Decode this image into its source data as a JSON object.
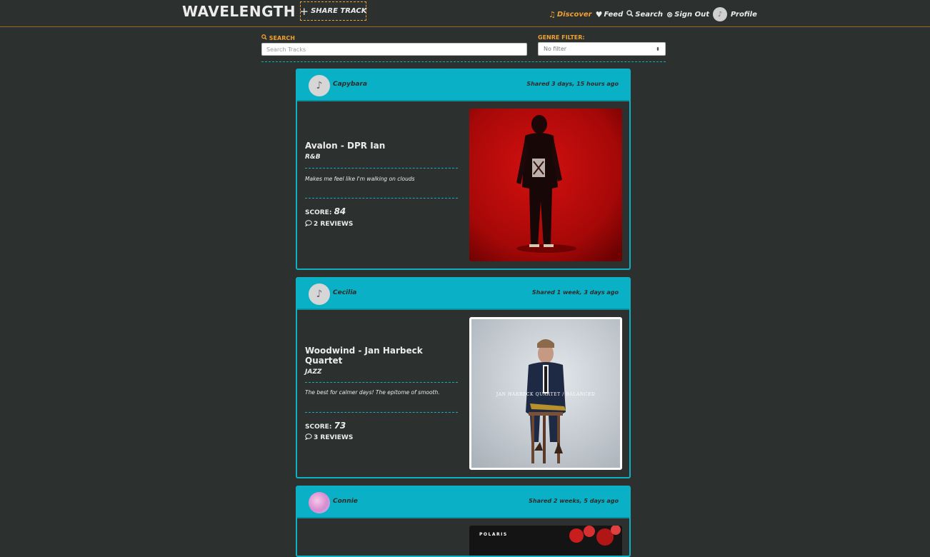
{
  "nav": {
    "brand": "WAVELENGTH",
    "share_label": "SHARE TRACK",
    "links": [
      {
        "label": "Discover",
        "icon": "music-note-icon"
      },
      {
        "label": "Feed",
        "icon": "heart-icon"
      },
      {
        "label": "Search",
        "icon": "search-icon"
      },
      {
        "label": "Sign Out",
        "icon": "close-circle-icon"
      },
      {
        "label": "Profile",
        "icon": "avatar"
      }
    ],
    "active": "Discover",
    "accent_color": "#f0a030"
  },
  "filters": {
    "search_label": "SEARCH",
    "search_placeholder": "Search Tracks",
    "genre_label": "GENRE FILTER:",
    "genre_value": "No filter"
  },
  "posts": [
    {
      "user": "Capybara",
      "shared": "Shared 3 days, 15 hours ago",
      "title": "Avalon - DPR Ian",
      "genre": "R&B",
      "description": "Makes me feel like I'm walking on clouds",
      "score_label": "SCORE:",
      "score": "84",
      "reviews": "2 REVIEWS"
    },
    {
      "user": "Cecilia",
      "shared": "Shared 1 week, 3 days ago",
      "title": "Woodwind - Jan Harbeck Quartet",
      "genre": "JAZZ",
      "description": "The best for calmer days! The epitome of smooth.",
      "score_label": "SCORE:",
      "score": "73",
      "reviews": "3 REVIEWS",
      "cover_text": "JAN HARBECK QUARTET / BALANCED"
    },
    {
      "user": "Connie",
      "shared": "Shared 2 weeks, 5 days ago",
      "cover_text": "POLARIS"
    }
  ],
  "colors": {
    "background": "#2c302e",
    "card_header": "#0ab0c5",
    "card_border": "#0fb0c4"
  }
}
